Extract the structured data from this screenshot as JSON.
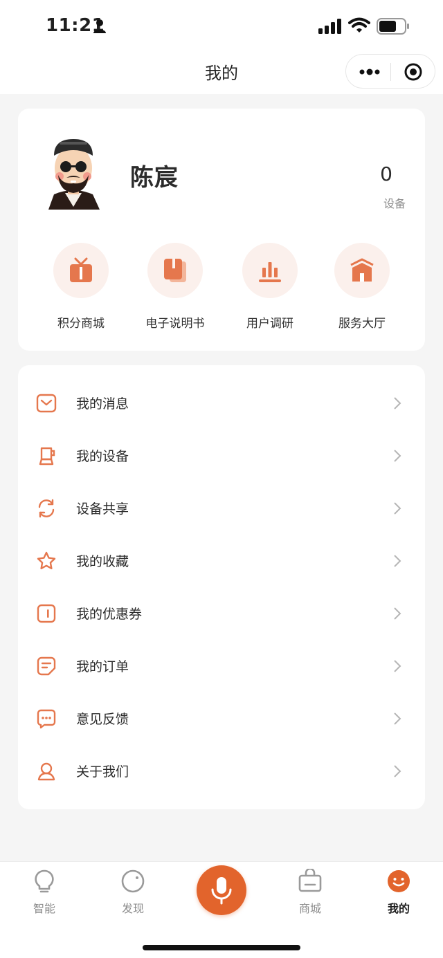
{
  "status_bar": {
    "time": "11:21"
  },
  "nav": {
    "title": "我的"
  },
  "profile": {
    "name": "陈宸",
    "device_count": "0",
    "device_label": "设备"
  },
  "quick_actions": [
    {
      "label": "积分商城",
      "icon": "gift-icon"
    },
    {
      "label": "电子说明书",
      "icon": "manual-icon"
    },
    {
      "label": "用户调研",
      "icon": "survey-chart-icon"
    },
    {
      "label": "服务大厅",
      "icon": "service-hall-icon"
    }
  ],
  "menu": [
    {
      "label": "我的消息",
      "icon": "message-icon"
    },
    {
      "label": "我的设备",
      "icon": "device-icon"
    },
    {
      "label": "设备共享",
      "icon": "share-refresh-icon"
    },
    {
      "label": "我的收藏",
      "icon": "star-icon"
    },
    {
      "label": "我的优惠券",
      "icon": "coupon-icon"
    },
    {
      "label": "我的订单",
      "icon": "order-icon"
    },
    {
      "label": "意见反馈",
      "icon": "feedback-icon"
    },
    {
      "label": "关于我们",
      "icon": "about-icon"
    }
  ],
  "tabs": [
    {
      "label": "智能",
      "icon": "bulb-icon",
      "active": false
    },
    {
      "label": "发现",
      "icon": "discover-icon",
      "active": false
    },
    {
      "label": "",
      "icon": "mic-icon",
      "active": false
    },
    {
      "label": "商城",
      "icon": "shop-bag-icon",
      "active": false
    },
    {
      "label": "我的",
      "icon": "smile-icon",
      "active": true
    }
  ],
  "colors": {
    "accent": "#e2642c",
    "icon_orange": "#e5774d",
    "quick_bg": "#fbf0ec",
    "page_bg": "#f5f5f5"
  }
}
